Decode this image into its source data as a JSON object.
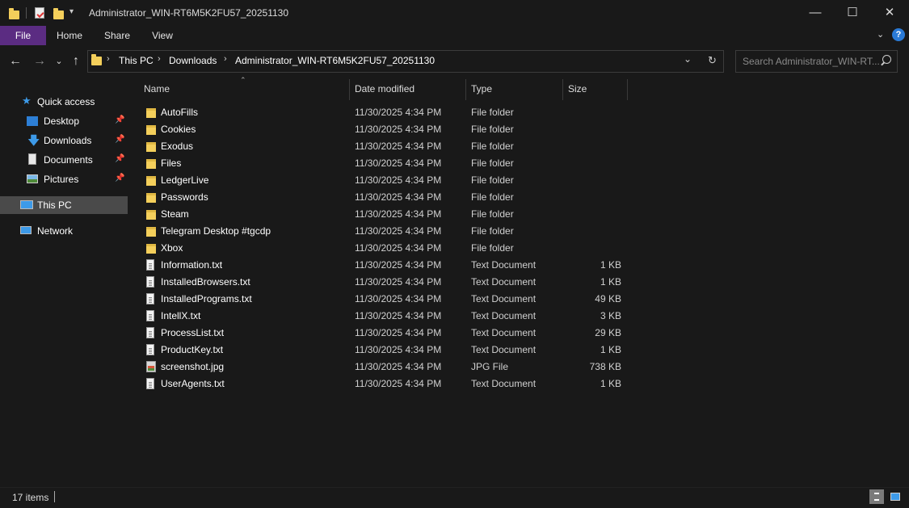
{
  "window": {
    "title": "Administrator_WIN-RT6M5K2FU57_20251130",
    "minimize": "—",
    "maximize": "☐",
    "close": "✕"
  },
  "ribbon": {
    "tabs": [
      "File",
      "Home",
      "Share",
      "View"
    ]
  },
  "nav": {
    "back": "←",
    "forward": "→",
    "recent": "⌄",
    "up": "↑"
  },
  "address": {
    "crumbs": [
      "This PC",
      "Downloads",
      "Administrator_WIN-RT6M5K2FU57_20251130"
    ],
    "separator": "›"
  },
  "search": {
    "placeholder": "Search Administrator_WIN-RT..."
  },
  "navpane": {
    "quick_access": "Quick access",
    "desktop": "Desktop",
    "downloads": "Downloads",
    "documents": "Documents",
    "pictures": "Pictures",
    "this_pc": "This PC",
    "network": "Network"
  },
  "columns": {
    "name": "Name",
    "date": "Date modified",
    "type": "Type",
    "size": "Size"
  },
  "files": [
    {
      "name": "AutoFills",
      "date": "11/30/2025 4:34 PM",
      "type": "File folder",
      "size": "",
      "icon": "folder"
    },
    {
      "name": "Cookies",
      "date": "11/30/2025 4:34 PM",
      "type": "File folder",
      "size": "",
      "icon": "folder"
    },
    {
      "name": "Exodus",
      "date": "11/30/2025 4:34 PM",
      "type": "File folder",
      "size": "",
      "icon": "folder"
    },
    {
      "name": "Files",
      "date": "11/30/2025 4:34 PM",
      "type": "File folder",
      "size": "",
      "icon": "folder"
    },
    {
      "name": "LedgerLive",
      "date": "11/30/2025 4:34 PM",
      "type": "File folder",
      "size": "",
      "icon": "folder"
    },
    {
      "name": "Passwords",
      "date": "11/30/2025 4:34 PM",
      "type": "File folder",
      "size": "",
      "icon": "folder"
    },
    {
      "name": "Steam",
      "date": "11/30/2025 4:34 PM",
      "type": "File folder",
      "size": "",
      "icon": "folder"
    },
    {
      "name": "Telegram Desktop #tgcdp",
      "date": "11/30/2025 4:34 PM",
      "type": "File folder",
      "size": "",
      "icon": "folder"
    },
    {
      "name": "Xbox",
      "date": "11/30/2025 4:34 PM",
      "type": "File folder",
      "size": "",
      "icon": "folder"
    },
    {
      "name": "Information.txt",
      "date": "11/30/2025 4:34 PM",
      "type": "Text Document",
      "size": "1 KB",
      "icon": "text"
    },
    {
      "name": "InstalledBrowsers.txt",
      "date": "11/30/2025 4:34 PM",
      "type": "Text Document",
      "size": "1 KB",
      "icon": "text"
    },
    {
      "name": "InstalledPrograms.txt",
      "date": "11/30/2025 4:34 PM",
      "type": "Text Document",
      "size": "49 KB",
      "icon": "text"
    },
    {
      "name": "IntellX.txt",
      "date": "11/30/2025 4:34 PM",
      "type": "Text Document",
      "size": "3 KB",
      "icon": "text"
    },
    {
      "name": "ProcessList.txt",
      "date": "11/30/2025 4:34 PM",
      "type": "Text Document",
      "size": "29 KB",
      "icon": "text"
    },
    {
      "name": "ProductKey.txt",
      "date": "11/30/2025 4:34 PM",
      "type": "Text Document",
      "size": "1 KB",
      "icon": "text"
    },
    {
      "name": "screenshot.jpg",
      "date": "11/30/2025 4:34 PM",
      "type": "JPG File",
      "size": "738 KB",
      "icon": "image"
    },
    {
      "name": "UserAgents.txt",
      "date": "11/30/2025 4:34 PM",
      "type": "Text Document",
      "size": "1 KB",
      "icon": "text"
    }
  ],
  "status": {
    "count": "17 items"
  },
  "colors": {
    "accent": "#5b2c82",
    "folder": "#f4cf5b",
    "background": "#191919",
    "selected": "#4a4a4a"
  }
}
